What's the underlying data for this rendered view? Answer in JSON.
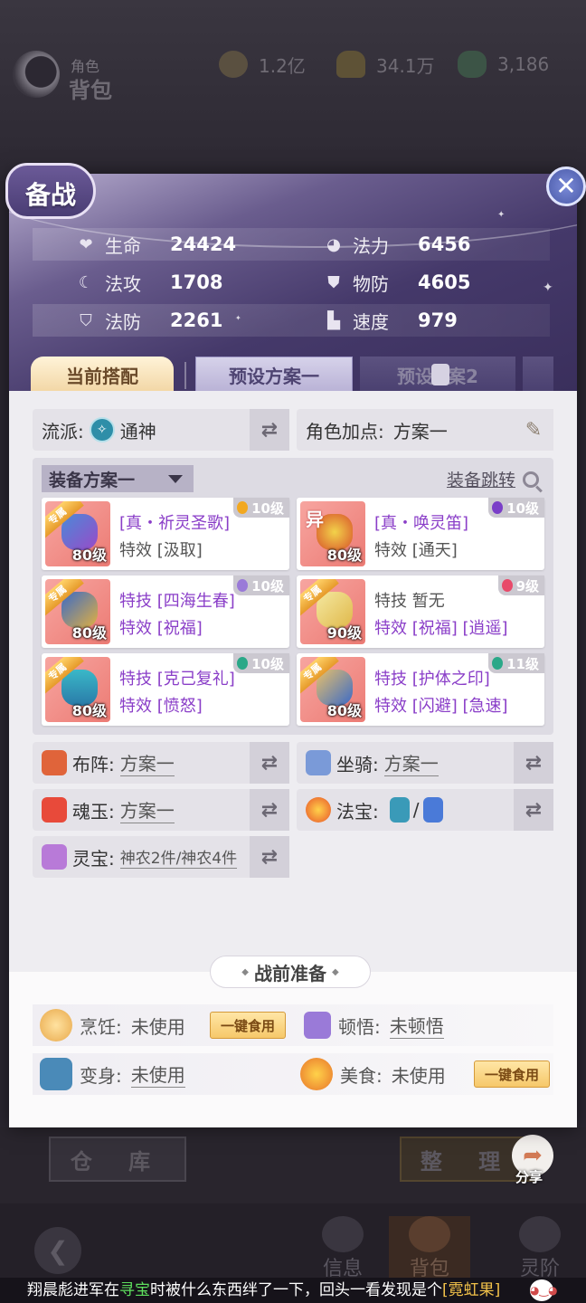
{
  "background": {
    "section_small": "角色",
    "section_title": "背包",
    "currencies": [
      {
        "icon": "coin-icon",
        "value": "1.2亿"
      },
      {
        "icon": "ingot-icon",
        "value": "34.1万"
      },
      {
        "icon": "jade-icon",
        "value": "3,186"
      }
    ],
    "warehouse_label": "仓 库",
    "sort_label": "整 理",
    "share_label": "分享",
    "nav": [
      {
        "label": "信息"
      },
      {
        "label": "背包"
      },
      {
        "label": "灵阶"
      }
    ]
  },
  "ticker": {
    "p1": "翔晨彪进军在",
    "p2": "寻宝",
    "p3": "时被什么东西绊了一下，回头一看发现是个",
    "p4": "[霓虹果]"
  },
  "modal": {
    "title": "备战",
    "stats": [
      {
        "icon": "heart-icon",
        "label": "生命",
        "value": "24424"
      },
      {
        "icon": "mana-icon",
        "label": "法力",
        "value": "6456"
      },
      {
        "icon": "magic-attack-icon",
        "label": "法攻",
        "value": "1708"
      },
      {
        "icon": "physical-defense-icon",
        "label": "物防",
        "value": "4605"
      },
      {
        "icon": "magic-defense-icon",
        "label": "法防",
        "value": "2261"
      },
      {
        "icon": "speed-boot-icon",
        "label": "速度",
        "value": "979"
      }
    ],
    "tabs": [
      "当前搭配",
      "预设方案一",
      "预设",
      "案2"
    ],
    "school_label": "流派:",
    "school_value": "通神",
    "points_label": "角色加点:",
    "points_value": "方案一",
    "equip_dropdown": "装备方案一",
    "equip_jump": "装备跳转",
    "equipment": [
      {
        "tag": "专属",
        "level": "80级",
        "gem_level": "10级",
        "line1": "[真・祈灵圣歌]",
        "line2": "特效 [汲取]"
      },
      {
        "tag": "异",
        "level": "80级",
        "gem_level": "10级",
        "line1": "[真・唤灵笛]",
        "line2": "特效 [通天]"
      },
      {
        "tag": "专属",
        "level": "80级",
        "gem_level": "10级",
        "line1": "特技 [四海生春]",
        "line2": "特效 [祝福]"
      },
      {
        "tag": "专属",
        "level": "90级",
        "gem_level": "9级",
        "line1": "特技  暂无",
        "line2": "特效 [祝福] [逍遥]"
      },
      {
        "tag": "专属",
        "level": "80级",
        "gem_level": "10级",
        "line1": "特技 [克己复礼]",
        "line2": "特效 [愤怒]"
      },
      {
        "tag": "专属",
        "level": "80级",
        "gem_level": "11级",
        "line1": "特技 [护体之印]",
        "line2": "特效 [闪避] [急速]"
      }
    ],
    "options": [
      {
        "label": "布阵:",
        "value": "方案一"
      },
      {
        "label": "坐骑:",
        "value": "方案一"
      },
      {
        "label": "魂玉:",
        "value": "方案一"
      },
      {
        "label": "法宝:",
        "value": "/"
      },
      {
        "label": "灵宝:",
        "value": "神农2件/神农4件"
      }
    ],
    "prep_title": "战前准备",
    "prep": [
      {
        "label": "烹饪:",
        "value": "未使用",
        "button": "一键食用"
      },
      {
        "label": "顿悟:",
        "value": "未顿悟"
      },
      {
        "label": "变身:",
        "value": "未使用"
      },
      {
        "label": "美食:",
        "value": "未使用",
        "button": "一键食用"
      }
    ]
  }
}
